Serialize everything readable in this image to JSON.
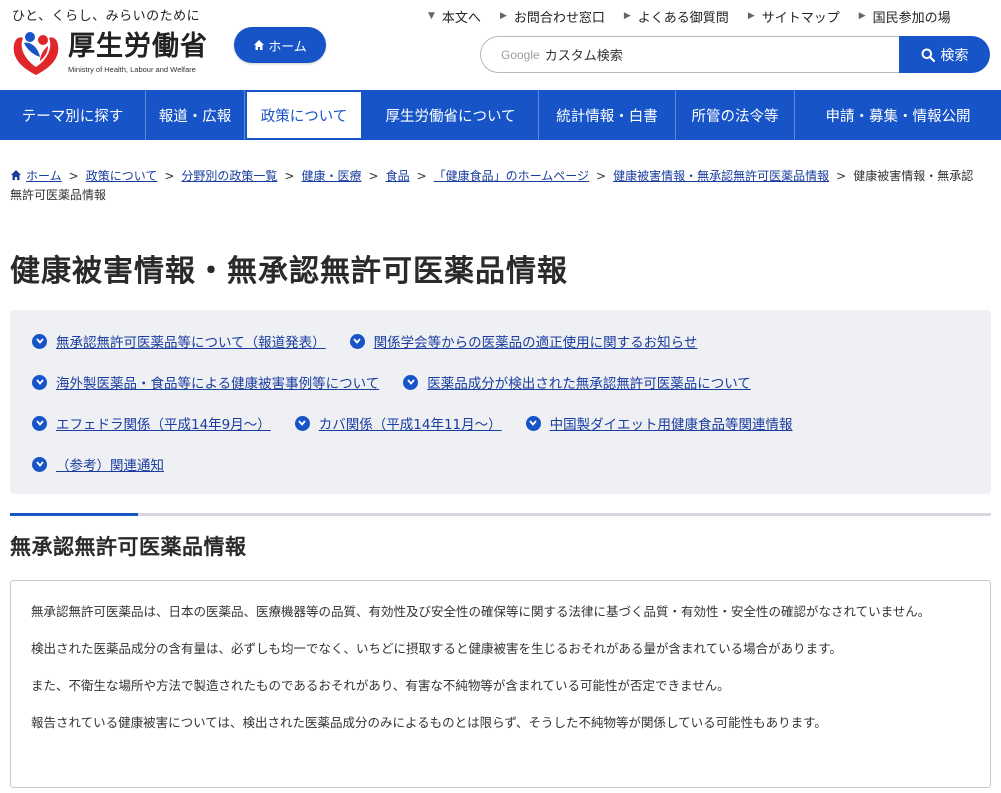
{
  "header": {
    "tagline": "ひと、くらし、みらいのために",
    "logo_text": "厚生労働省",
    "logo_en": "Ministry of Health, Labour and Welfare",
    "home_label": "ホーム",
    "util_nav": [
      "本文へ",
      "お問合わせ窓口",
      "よくある御質問",
      "サイトマップ",
      "国民参加の場"
    ],
    "search_brand": "Google",
    "search_placeholder": "カスタム検索",
    "search_button": "検索"
  },
  "main_nav": [
    {
      "label": "テーマ別に探す"
    },
    {
      "label": "報道・広報"
    },
    {
      "label": "政策について",
      "active": true
    },
    {
      "label": "厚生労働省について"
    },
    {
      "label": "統計情報・白書"
    },
    {
      "label": "所管の法令等"
    },
    {
      "label": "申請・募集・情報公開"
    }
  ],
  "breadcrumb": {
    "links": [
      "ホーム",
      "政策について",
      "分野別の政策一覧",
      "健康・医療",
      "食品",
      "「健康食品」のホームページ",
      "健康被害情報・無承認無許可医薬品情報"
    ],
    "current": "健康被害情報・無承認無許可医薬品情報"
  },
  "page_title": "健康被害情報・無承認無許可医薬品情報",
  "anchors": [
    [
      "無承認無許可医薬品等について（報道発表）",
      "関係学会等からの医薬品の適正使用に関するお知らせ"
    ],
    [
      "海外製医薬品・食品等による健康被害事例等について",
      "医薬品成分が検出された無承認無許可医薬品について"
    ],
    [
      "エフェドラ関係（平成14年9月～）",
      "カバ関係（平成14年11月～）",
      "中国製ダイエット用健康食品等関連情報"
    ],
    [
      "（参考）関連通知"
    ]
  ],
  "section": {
    "title": "無承認無許可医薬品情報",
    "paragraphs": [
      "無承認無許可医薬品は、日本の医薬品、医療機器等の品質、有効性及び安全性の確保等に関する法律に基づく品質・有効性・安全性の確認がなされていません。",
      "検出された医薬品成分の含有量は、必ずしも均一でなく、いちどに摂取すると健康被害を生じるおそれがある量が含まれている場合があります。",
      "また、不衛生な場所や方法で製造されたものであるおそれがあり、有害な不純物等が含まれている可能性が否定できません。",
      "報告されている健康被害については、検出された医薬品成分のみによるものとは限らず、そうした不純物等が関係している可能性もあります。"
    ]
  },
  "colors": {
    "brand_blue": "#1654c8",
    "link": "#1a3d9e",
    "anchor_bg": "#eef0f4"
  }
}
